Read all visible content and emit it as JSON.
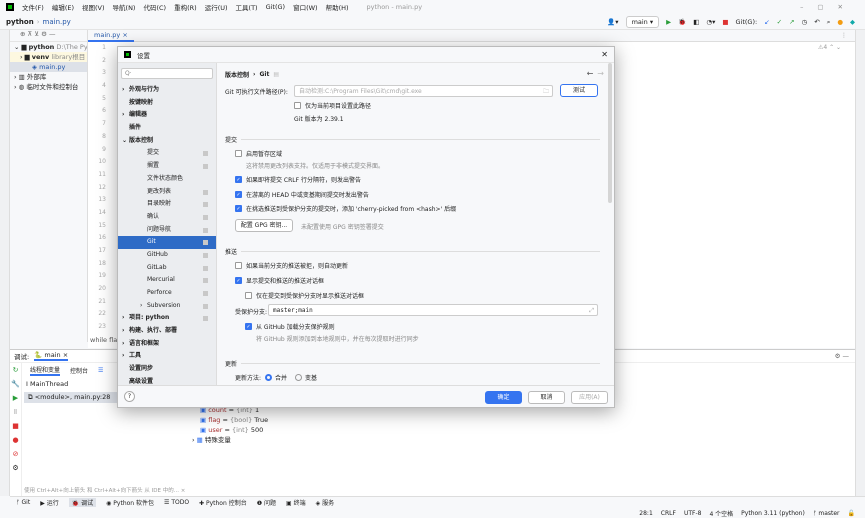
{
  "window": {
    "title": "python - main.py",
    "menu": [
      "文件(F)",
      "编辑(E)",
      "视图(V)",
      "导航(N)",
      "代码(C)",
      "重构(R)",
      "运行(U)",
      "工具(T)",
      "Git(G)",
      "窗口(W)",
      "帮助(H)"
    ]
  },
  "breadcrumb": {
    "project": "python",
    "file": "main.py"
  },
  "toolbar": {
    "run_config": "main",
    "git_label": "Git(G):"
  },
  "project_tree": [
    {
      "label": "python",
      "hint": "D:\\The Py"
    },
    {
      "label": "venv",
      "hint": "library根目"
    },
    {
      "label": "main.py"
    },
    {
      "label": "外部库"
    },
    {
      "label": "临时文件和控制台"
    }
  ],
  "editor": {
    "tab": "main.py",
    "warnings": "4",
    "lines": [
      "1",
      "2",
      "3",
      "4",
      "5",
      "6",
      "7",
      "8",
      "9",
      "10",
      "11",
      "12",
      "13",
      "14",
      "15",
      "16",
      "17",
      "18",
      "19",
      "20",
      "21",
      "22",
      "23"
    ],
    "snippet": "while fla"
  },
  "dialog": {
    "title": "设置",
    "search_placeholder": "Q·",
    "nav": [
      {
        "label": "外观与行为",
        "level": 0,
        "bold": true,
        "arrow": ">"
      },
      {
        "label": "按键映射",
        "level": 0,
        "bold": true
      },
      {
        "label": "编辑器",
        "level": 0,
        "bold": true,
        "arrow": ">"
      },
      {
        "label": "插件",
        "level": 0,
        "bold": true
      },
      {
        "label": "版本控制",
        "level": 0,
        "bold": true,
        "arrow": "v"
      },
      {
        "label": "提交",
        "level": 1
      },
      {
        "label": "搁置",
        "level": 1
      },
      {
        "label": "文件状态颜色",
        "level": 1
      },
      {
        "label": "更改列表",
        "level": 1
      },
      {
        "label": "目录映射",
        "level": 1
      },
      {
        "label": "确认",
        "level": 1
      },
      {
        "label": "问题导航",
        "level": 1
      },
      {
        "label": "Git",
        "level": 1,
        "selected": true
      },
      {
        "label": "GitHub",
        "level": 1
      },
      {
        "label": "GitLab",
        "level": 1
      },
      {
        "label": "Mercurial",
        "level": 1
      },
      {
        "label": "Perforce",
        "level": 1
      },
      {
        "label": "Subversion",
        "level": 1,
        "arrow": ">"
      },
      {
        "label": "项目: python",
        "level": 0,
        "bold": true,
        "arrow": ">"
      },
      {
        "label": "构建、执行、部署",
        "level": 0,
        "bold": true,
        "arrow": ">"
      },
      {
        "label": "语言和框架",
        "level": 0,
        "bold": true,
        "arrow": ">"
      },
      {
        "label": "工具",
        "level": 0,
        "bold": true,
        "arrow": ">"
      },
      {
        "label": "设置同步",
        "level": 0,
        "bold": true
      },
      {
        "label": "高级设置",
        "level": 0,
        "bold": true
      }
    ],
    "breadcrumb": [
      "版本控制",
      "Git"
    ],
    "git_path_label": "Git 可执行文件路径(P):",
    "git_path_placeholder": "自动检测:C:\\Program Files\\Git\\cmd\\git.exe",
    "test_button": "测试",
    "project_only": {
      "label": "仅为当前项目设置此路径",
      "checked": false
    },
    "git_version": "Git 版本为 2.39.1",
    "commit_section": "提交",
    "staging": {
      "label": "启用暂存区域",
      "checked": false,
      "hint": "这将禁用更改列表支持。仅适用于非模式提交界面。"
    },
    "crlf": {
      "label": "如果即将提交 CRLF 行分隔符，则发出警告",
      "checked": true
    },
    "detached": {
      "label": "在游离的 HEAD 中或变基期间提交时发出警告",
      "checked": true
    },
    "cherry": {
      "label": "在挑选推送到受保护分支的提交时，添加 'cherry-picked from <hash>' 后缀",
      "checked": true
    },
    "gpg_button": "配置 GPG 密钥...",
    "gpg_hint": "未配置使用 GPG 密钥签署提交",
    "push_section": "推送",
    "auto_update": {
      "label": "如果当前分支的推送被拒，则自动更新",
      "checked": false
    },
    "show_push": {
      "label": "显示提交和推送的推送对话框",
      "checked": true
    },
    "protected_only": {
      "label": "仅在提交到受保护分支时显示推送对话框",
      "checked": false
    },
    "protected_label": "受保护分支:",
    "protected_value": "master;main",
    "github_rules": {
      "label": "从 GitHub 加载分支保护规则",
      "checked": true,
      "hint": "将 GitHub 规则添加到本地规则中，并在每次提取时进行同步"
    },
    "update_section": "更新",
    "update_method_label": "更新方法:",
    "update_options": [
      {
        "label": "合并",
        "selected": true
      },
      {
        "label": "变基",
        "selected": false
      }
    ],
    "ok": "确定",
    "cancel": "取消",
    "apply": "应用(A)"
  },
  "debug": {
    "label": "调试:",
    "config": "main",
    "tabs": [
      "线程和变量",
      "控制台"
    ],
    "thread": "MainThread",
    "frame": "<module>, main.py:28",
    "vars": [
      {
        "name": "count",
        "type": "{int}",
        "value": "1"
      },
      {
        "name": "flag",
        "type": "{bool}",
        "value": "True"
      },
      {
        "name": "user",
        "type": "{int}",
        "value": "500"
      }
    ],
    "special": "特殊变量",
    "hint": "使用 Ctrl+Alt+向上箭头 和 Ctrl+Alt+向下箭头 从 IDE 中的..."
  },
  "bottom_tools": [
    "Git",
    "运行",
    "调试",
    "Python 软件包",
    "TODO",
    "Python 控制台",
    "问题",
    "终端",
    "服务"
  ],
  "status": [
    "28:1",
    "CRLF",
    "UTF-8",
    "4 个空格",
    "Python 3.11 (python)",
    "master"
  ]
}
